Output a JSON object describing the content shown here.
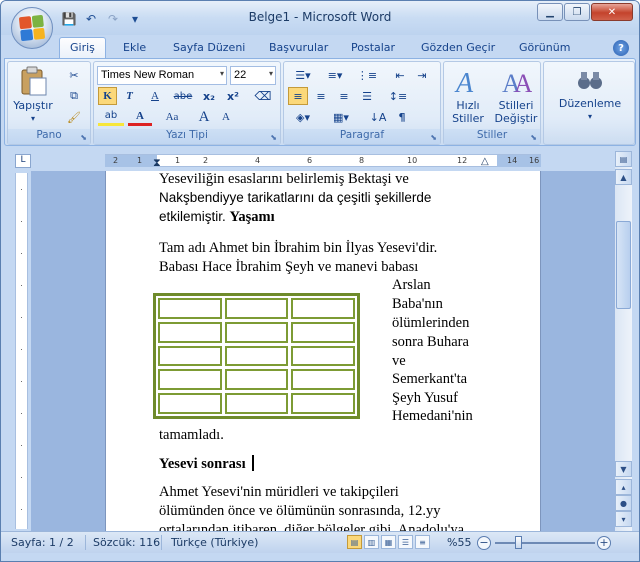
{
  "window": {
    "title": "Belge1 - Microsoft Word"
  },
  "quick_access": {
    "save": "💾",
    "undo": "↶",
    "redo": "↷",
    "customize": "▾"
  },
  "window_controls": {
    "minimize": "▁",
    "maximize": "❐",
    "close": "✕"
  },
  "tabs": [
    {
      "label": "Giriş",
      "active": true
    },
    {
      "label": "Ekle"
    },
    {
      "label": "Sayfa Düzeni"
    },
    {
      "label": "Başvurular"
    },
    {
      "label": "Postalar"
    },
    {
      "label": "Gözden Geçir"
    },
    {
      "label": "Görünüm"
    }
  ],
  "ribbon": {
    "clipboard": {
      "group_label": "Pano",
      "paste_label": "Yapıştır",
      "paste_arrow": "▾"
    },
    "font": {
      "group_label": "Yazı Tipi",
      "font_name": "Times New Roman",
      "font_size": "22",
      "grow": "A",
      "shrink": "A",
      "bold": "K",
      "italic": "T",
      "underline": "A",
      "strike": "abe",
      "subscript": "x₂",
      "superscript": "x²",
      "change_case": "Aa",
      "font_color": "A",
      "highlight": "ab"
    },
    "paragraph": {
      "group_label": "Paragraf",
      "pilcrow": "¶"
    },
    "styles": {
      "group_label": "Stiller",
      "quick_styles": "Hızlı\nStiller",
      "change_styles": "Stilleri\nDeğiştir"
    },
    "editing": {
      "label": "Düzenleme"
    }
  },
  "ruler": {
    "ticks": [
      "2",
      "1",
      "1",
      "2",
      "4",
      "6",
      "8",
      "10",
      "12",
      "14",
      "16",
      "18"
    ],
    "vticks": [
      "10",
      "11",
      "12",
      "13",
      "14",
      "15",
      "16",
      "17",
      "18",
      "19",
      "20",
      "21"
    ]
  },
  "document": {
    "p1_line1": "Yeseviliğin esaslarını belirlemiş Bektaşi ve",
    "p1_line2": "Nakşbendiyye tarikatlarını da çeşitli şekillerde",
    "p1_line3_text": "etkilemiştir. ",
    "p1_line3_bold": "Yaşamı",
    "p2_line1": "Tam adı Ahmet bin İbrahim bin İlyas Yesevi'dir.",
    "p2_line2": "Babası Hace İbrahim Şeyh ve manevi babası",
    "wrap_lines": [
      "Arslan",
      "Baba'nın",
      "ölümlerinden",
      "sonra Buhara",
      "ve",
      "Semerkant'ta",
      "Şeyh Yusuf",
      "Hemedani'nin"
    ],
    "p2_end": "tamamladı.",
    "heading": "Yesevi sonrası",
    "p3_line1": "Ahmet Yesevi'nin müridleri ve takipçileri",
    "p3_line2": "ölümünden önce ve ölümünün sonrasında, 12.yy",
    "p3_line3": "ortalarından itibaren, diğer bölgeler gibi, Anadolu'ya"
  },
  "statusbar": {
    "page": "Sayfa: 1 / 2",
    "words": "Sözcük: 116",
    "language": "Türkçe (Türkiye)",
    "zoom": "%55",
    "zoom_minus": "−",
    "zoom_plus": "+"
  },
  "colors": {
    "table_border": "#6f8b2b",
    "ribbon_bg": "#dde9f7"
  }
}
